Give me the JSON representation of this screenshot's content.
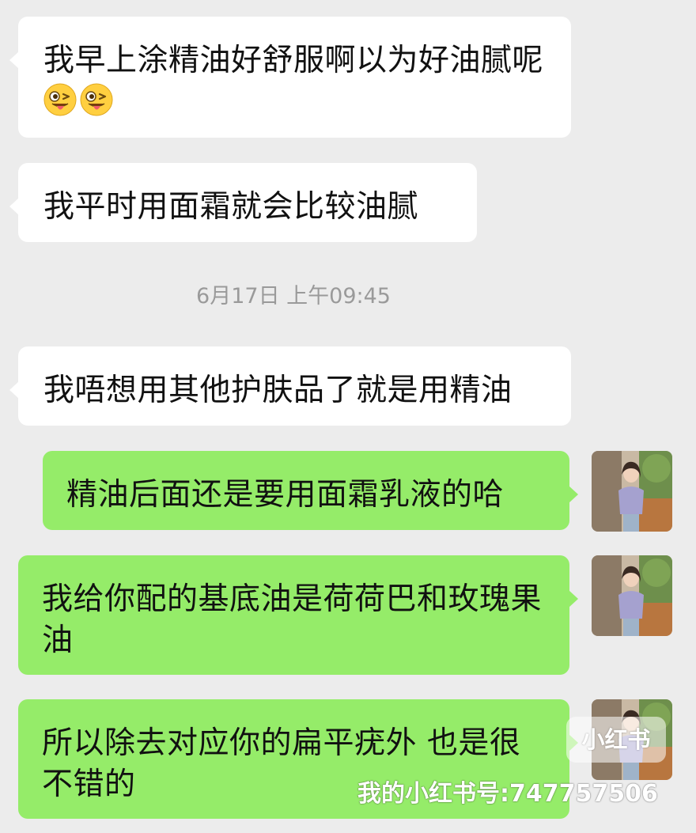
{
  "messages": [
    {
      "direction": "incoming",
      "text": "我早上涂精油好舒服啊以为好油腻呢",
      "emoji": [
        "winking-tongue-face-emoji",
        "winking-tongue-face-emoji"
      ]
    },
    {
      "direction": "incoming",
      "text": "我平时用面霜就会比较油腻"
    },
    {
      "direction": "incoming",
      "text": "我唔想用其他护肤品了就是用精油"
    },
    {
      "direction": "outgoing",
      "text": "精油后面还是要用面霜乳液的哈"
    },
    {
      "direction": "outgoing",
      "text": "我给你配的基底油是荷荷巴和玫瑰果油"
    },
    {
      "direction": "outgoing",
      "text": "所以除去对应你的扁平疣外 也是很不错的"
    }
  ],
  "timestamp": "6月17日 上午09:45",
  "watermark": {
    "logo_text": "小红书",
    "account_text": "我的小红书号:747757506"
  },
  "colors": {
    "background": "#ececec",
    "incoming_bubble": "#ffffff",
    "outgoing_bubble": "#95ec69",
    "timestamp_text": "#9a9a9a"
  }
}
